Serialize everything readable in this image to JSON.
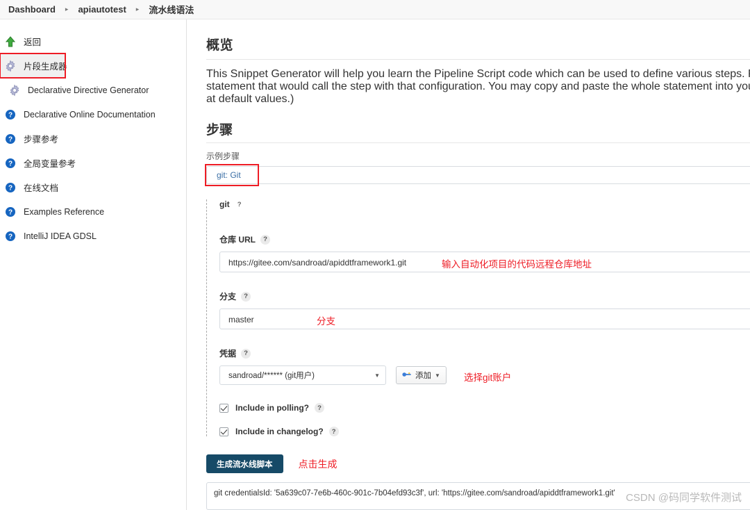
{
  "breadcrumb": {
    "items": [
      {
        "label": "Dashboard"
      },
      {
        "label": "apiautotest"
      },
      {
        "label": "流水线语法"
      }
    ],
    "separator": "▸"
  },
  "sidebar": {
    "items": [
      {
        "label": "返回",
        "icon": "up-arrow-icon"
      },
      {
        "label": "片段生成器",
        "icon": "gear-icon"
      },
      {
        "label": "Declarative Directive Generator",
        "icon": "gear-icon"
      },
      {
        "label": "Declarative Online Documentation",
        "icon": "help-icon"
      },
      {
        "label": "步骤参考",
        "icon": "help-icon"
      },
      {
        "label": "全局变量参考",
        "icon": "help-icon"
      },
      {
        "label": "在线文档",
        "icon": "help-icon"
      },
      {
        "label": "Examples Reference",
        "icon": "help-icon"
      },
      {
        "label": "IntelliJ IDEA GDSL",
        "icon": "help-icon"
      }
    ]
  },
  "overview": {
    "title": "概览",
    "paragraph_lines": [
      "This Snippet Generator will help you learn the Pipeline Script code which can be used to define various steps. Pick a step you are interested in from the",
      "statement that would call the step with that configuration. You may copy and paste the whole statement into your script, or pick up just the options you",
      "at default values.)"
    ],
    "bold_term": "Snippet Generator"
  },
  "steps": {
    "title": "步骤",
    "sample_step_label": "示例步骤",
    "selected_step": "git: Git"
  },
  "git_form": {
    "section_label": "git",
    "help_glyph": "?",
    "repo_url": {
      "label": "仓库 URL",
      "value": "https://gitee.com/sandroad/apiddtframework1.git",
      "annotation": "输入自动化项目的代码远程仓库地址"
    },
    "branch": {
      "label": "分支",
      "value": "master",
      "annotation": "分支"
    },
    "credentials": {
      "label": "凭据",
      "value": "sandroad/****** (git用户)",
      "add_button": "添加",
      "annotation": "选择git账户"
    },
    "checkboxes": [
      {
        "label": "Include in polling?",
        "checked": true
      },
      {
        "label": "Include in changelog?",
        "checked": true
      }
    ]
  },
  "generate": {
    "button_label": "生成流水线脚本",
    "annotation": "点击生成",
    "output": "git credentialsId: '5a639c07-7e6b-460c-901c-7b04efd93c3f', url: 'https://gitee.com/sandroad/apiddtframework1.git'"
  },
  "watermark": "CSDN @码同学软件测试"
}
